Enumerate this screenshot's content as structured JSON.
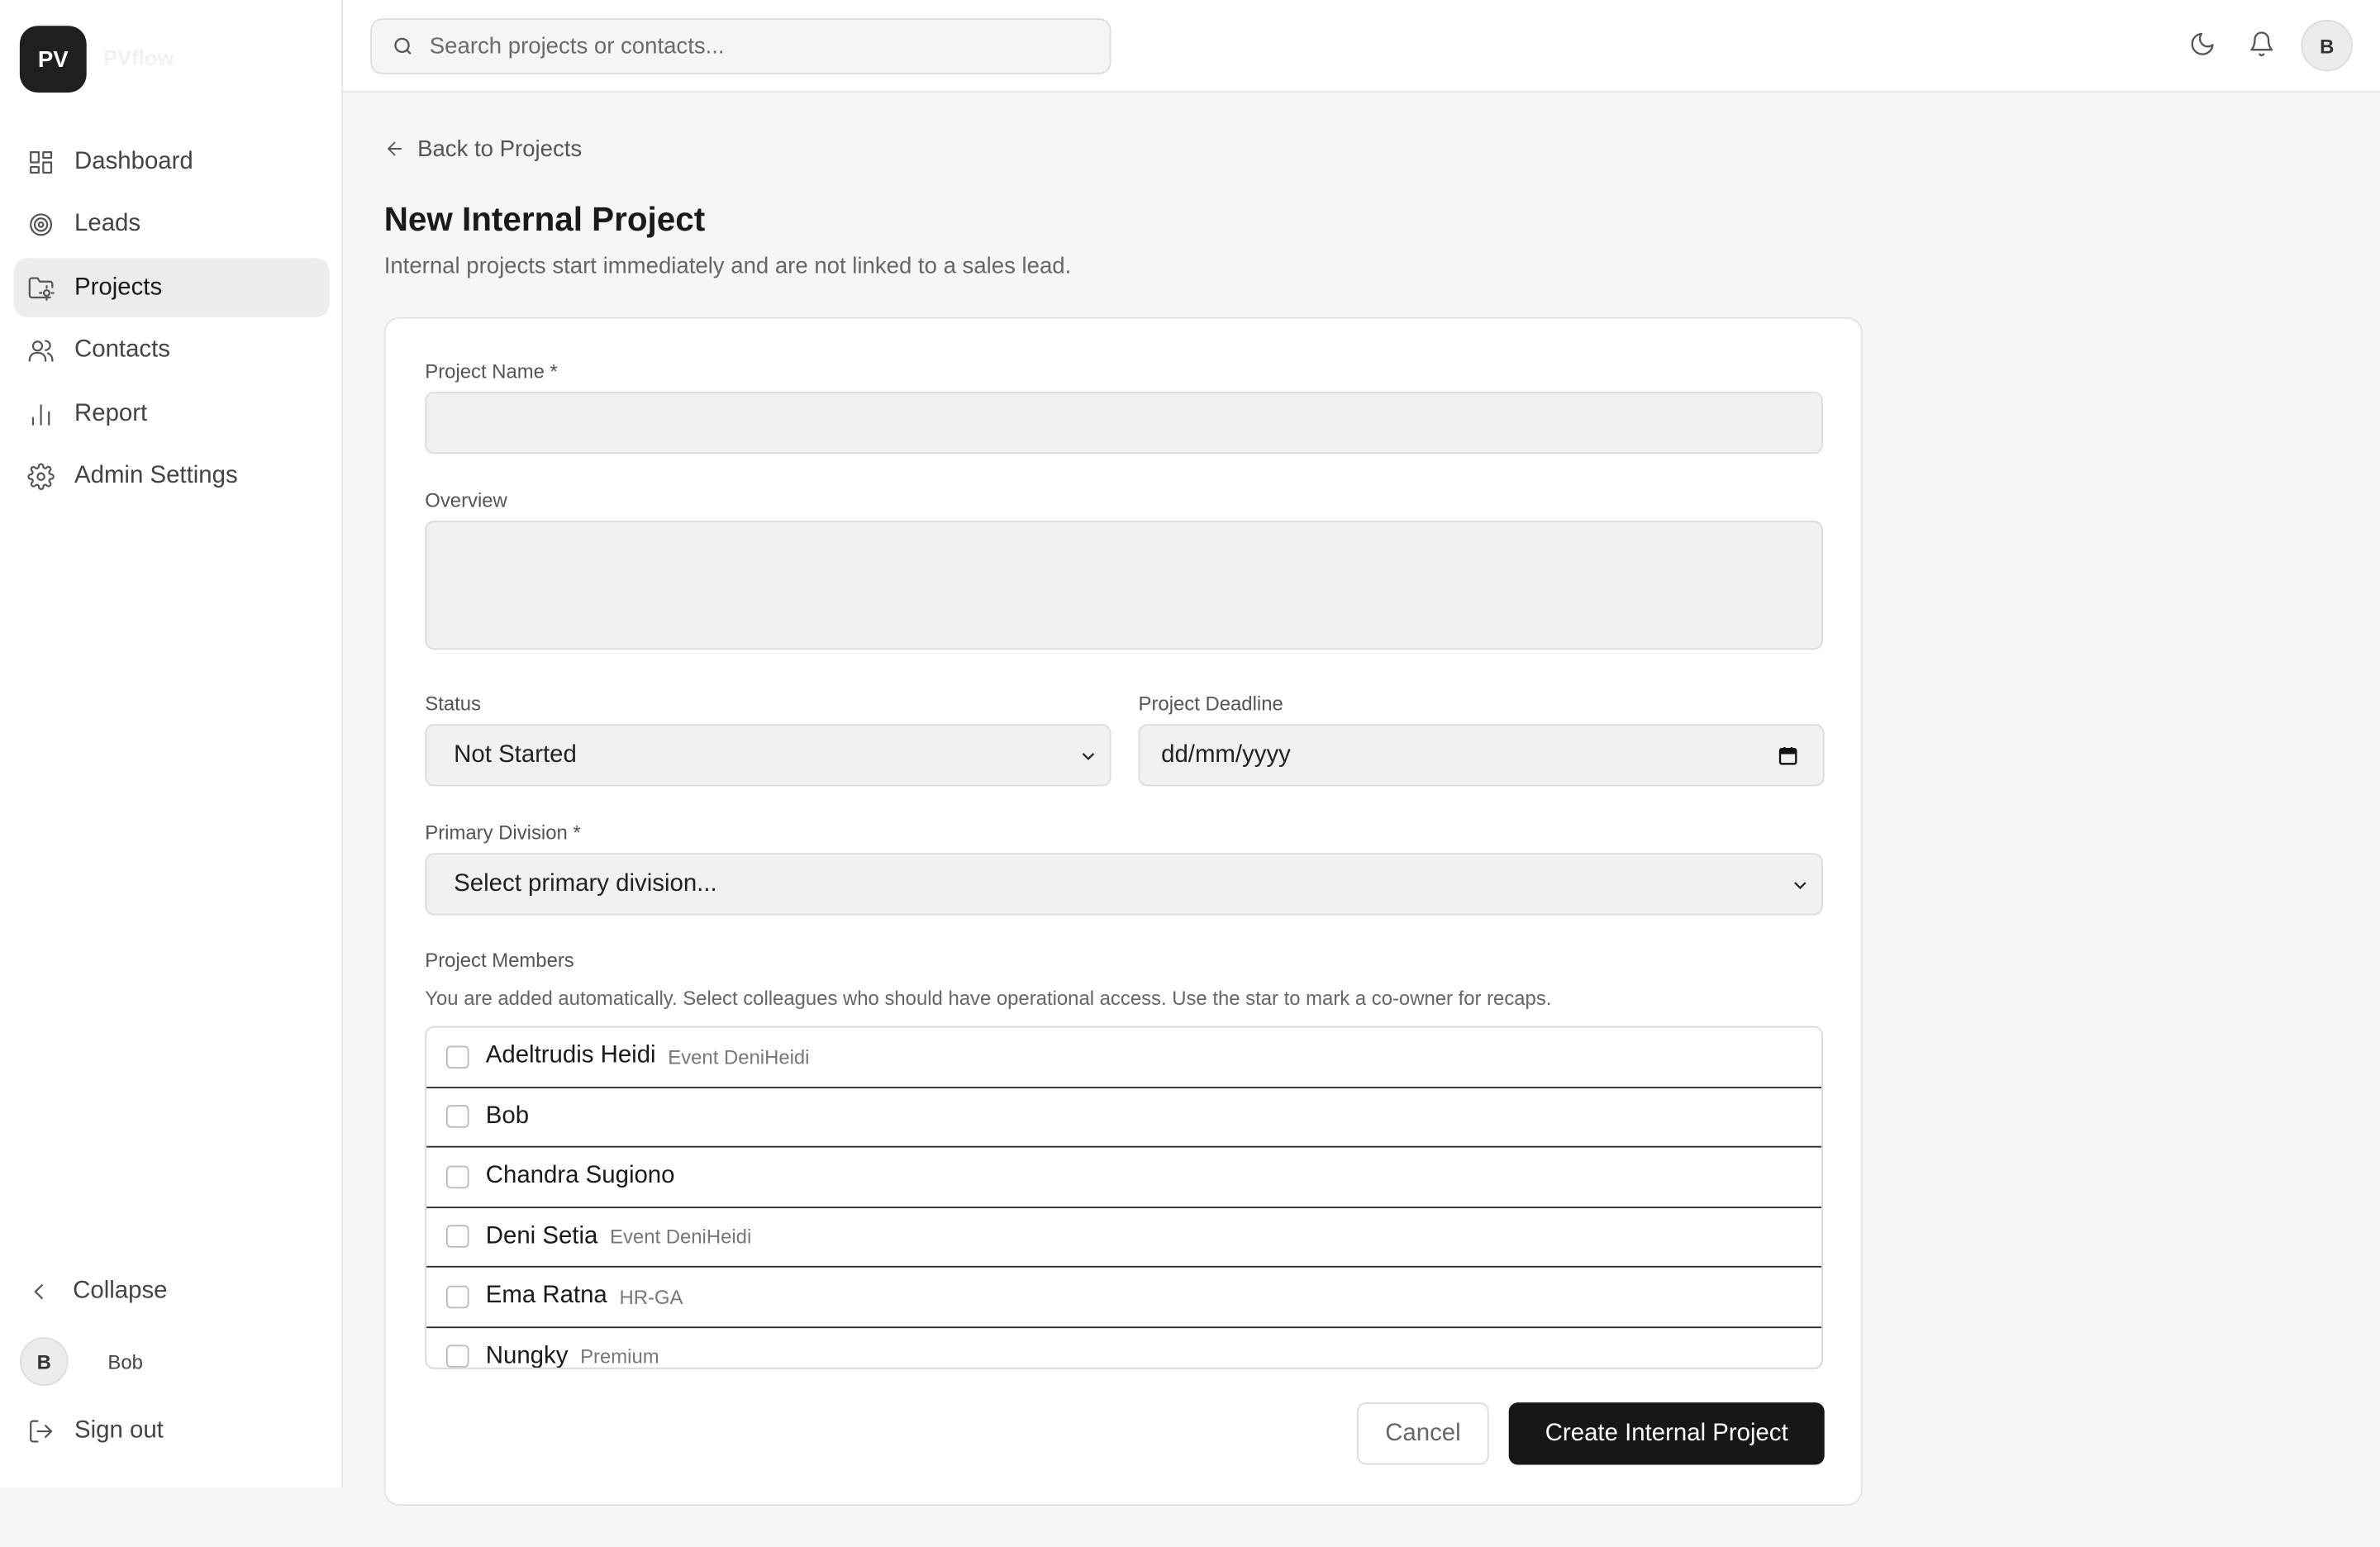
{
  "app": {
    "logo_initials": "PV",
    "logo_name": "PVflow"
  },
  "sidebar": {
    "items": [
      {
        "label": "Dashboard",
        "icon": "dashboard-icon"
      },
      {
        "label": "Leads",
        "icon": "target-icon"
      },
      {
        "label": "Projects",
        "icon": "folder-icon",
        "active": true
      },
      {
        "label": "Contacts",
        "icon": "users-icon"
      },
      {
        "label": "Report",
        "icon": "bar-chart-icon"
      },
      {
        "label": "Admin Settings",
        "icon": "gear-icon"
      }
    ],
    "collapse_label": "Collapse",
    "user": {
      "initial": "B",
      "name": "Bob"
    },
    "signout_label": "Sign out"
  },
  "topbar": {
    "search_placeholder": "Search projects or contacts...",
    "avatar_initial": "B"
  },
  "page": {
    "back_label": "Back to Projects",
    "title": "New Internal Project",
    "subtitle": "Internal projects start immediately and are not linked to a sales lead."
  },
  "form": {
    "project_name_label": "Project Name *",
    "project_name_value": "",
    "overview_label": "Overview",
    "overview_value": "",
    "status_label": "Status",
    "status_value": "Not Started",
    "deadline_label": "Project Deadline",
    "deadline_placeholder": "dd/mm/yyyy",
    "division_label": "Primary Division *",
    "division_value": "Select primary division...",
    "members_label": "Project Members",
    "members_help": "You are added automatically. Select colleagues who should have operational access. Use the star to mark a co-owner for recaps.",
    "members": [
      {
        "name": "Adeltrudis Heidi",
        "division": "Event DeniHeidi",
        "checked": false
      },
      {
        "name": "Bob",
        "division": "",
        "checked": false
      },
      {
        "name": "Chandra Sugiono",
        "division": "",
        "checked": false
      },
      {
        "name": "Deni Setia",
        "division": "Event DeniHeidi",
        "checked": false
      },
      {
        "name": "Ema Ratna",
        "division": "HR-GA",
        "checked": false
      },
      {
        "name": "Nungky",
        "division": "Premium",
        "checked": false
      }
    ],
    "cancel_label": "Cancel",
    "submit_label": "Create Internal Project"
  }
}
